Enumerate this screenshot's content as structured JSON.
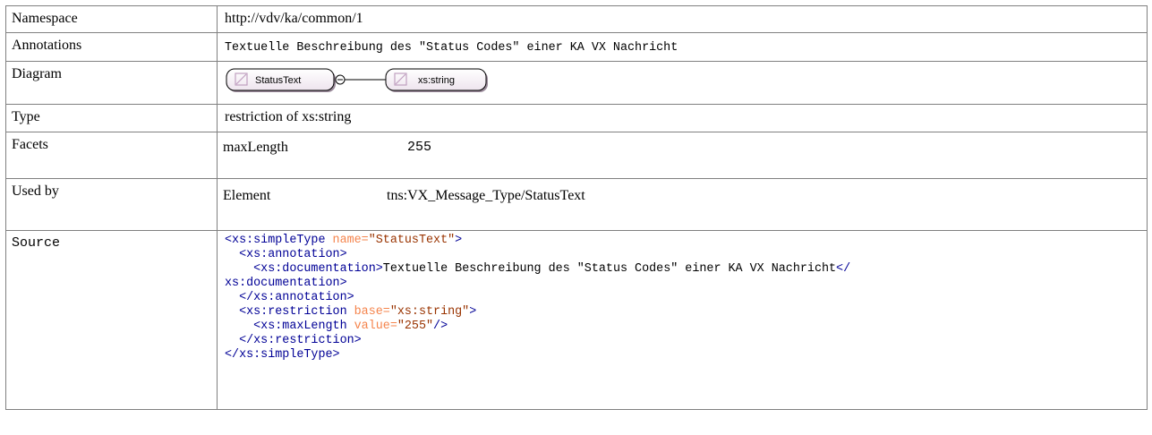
{
  "rows": {
    "namespace": {
      "label": "Namespace",
      "value": "http://vdv/ka/common/1"
    },
    "annotations": {
      "label": "Annotations",
      "value": "Textuelle Beschreibung des \"Status Codes\" einer KA VX Nachricht"
    },
    "diagram": {
      "label": "Diagram",
      "node1": "StatusText",
      "node2": "xs:string"
    },
    "type": {
      "label": "Type",
      "value": "restriction of xs:string"
    },
    "facets": {
      "label": "Facets",
      "name": "maxLength",
      "value": "255"
    },
    "used_by": {
      "label": "Used by",
      "kind": "Element",
      "ref": "tns:VX_Message_Type/StatusText"
    },
    "source": {
      "label": "Source"
    }
  },
  "source_code": {
    "l1_open": "<xs:simpleType",
    "l1_attr": " name=",
    "l1_val": "\"StatusText\"",
    "l1_close": ">",
    "l2": "  <xs:annotation>",
    "l3_open": "    <xs:documentation>",
    "l3_text": "Textuelle Beschreibung des \"Status Codes\" einer KA VX Nachricht",
    "l3_close": "</",
    "l4": "xs:documentation>",
    "l5": "  </xs:annotation>",
    "l6_open": "  <xs:restriction",
    "l6_attr": " base=",
    "l6_val": "\"xs:string\"",
    "l6_close": ">",
    "l7_open": "    <xs:maxLength",
    "l7_attr": " value=",
    "l7_val": "\"255\"",
    "l7_close": "/>",
    "l8": "  </xs:restriction>",
    "l9": "</xs:simpleType>"
  },
  "colors": {
    "tag": "#000096",
    "attribute": "#f5844c",
    "attribute_value": "#993300",
    "border": "#808080"
  }
}
